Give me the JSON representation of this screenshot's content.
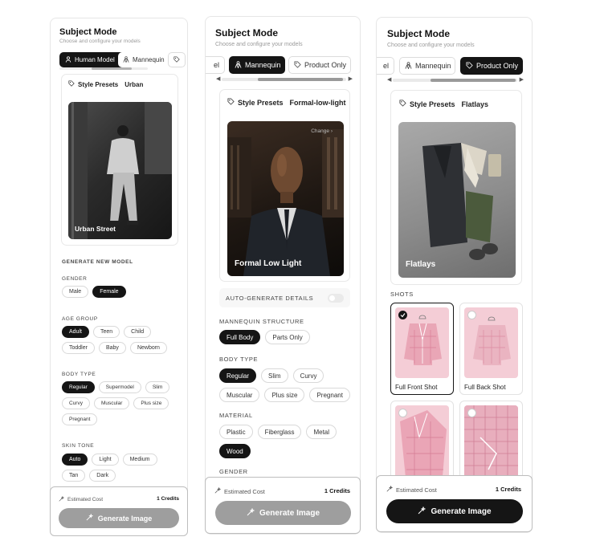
{
  "panel1": {
    "title": "Subject Mode",
    "subtitle": "Choose and configure your models",
    "tabs": [
      {
        "label": "Human Model",
        "icon": "person-icon",
        "active": true
      },
      {
        "label": "Mannequin",
        "icon": "mannequin-icon",
        "active": false
      }
    ],
    "presets_label": "Style Presets",
    "preset_value": "Urban",
    "image_caption": "Urban Street",
    "generate_heading": "GENERATE NEW MODEL",
    "gender_label": "GENDER",
    "gender": [
      "Male",
      "Female"
    ],
    "gender_selected": "Female",
    "age_label": "AGE GROUP",
    "age": [
      "Adult",
      "Teen",
      "Child",
      "Toddler",
      "Baby",
      "Newborn"
    ],
    "age_selected": "Adult",
    "body_label": "BODY TYPE",
    "body": [
      "Regular",
      "Supermodel",
      "Slim",
      "Curvy",
      "Muscular",
      "Plus size",
      "Pregnant"
    ],
    "body_selected": "Regular",
    "skin_label": "SKIN TONE",
    "skin": [
      "Auto",
      "Light",
      "Medium",
      "Tan",
      "Dark"
    ],
    "skin_selected": "Auto",
    "cost_label": "Estimated Cost",
    "credits": "1 Credits",
    "button": "Generate Image",
    "button_enabled": false
  },
  "panel2": {
    "title": "Subject Mode",
    "subtitle": "Choose and configure your models",
    "tabs": [
      {
        "label": "el",
        "icon": "",
        "active": false
      },
      {
        "label": "Mannequin",
        "icon": "mannequin-icon",
        "active": true
      },
      {
        "label": "Product Only",
        "icon": "tag-icon",
        "active": false
      }
    ],
    "presets_label": "Style Presets",
    "preset_value": "Formal-low-light",
    "image_caption": "Formal Low Light",
    "change_label": "Change",
    "auto_label": "AUTO-GENERATE DETAILS",
    "structure_label": "MANNEQUIN STRUCTURE",
    "structure": [
      "Full Body",
      "Parts Only"
    ],
    "structure_selected": "Full Body",
    "body_label": "BODY TYPE",
    "body": [
      "Regular",
      "Slim",
      "Curvy",
      "Muscular",
      "Plus size",
      "Pregnant"
    ],
    "body_selected": "Regular",
    "material_label": "MATERIAL",
    "material": [
      "Plastic",
      "Fiberglass",
      "Metal",
      "Wood"
    ],
    "material_selected": "Wood",
    "gender_label": "GENDER",
    "cost_label": "Estimated Cost",
    "credits": "1 Credits",
    "button": "Generate Image",
    "button_enabled": false
  },
  "panel3": {
    "title": "Subject Mode",
    "subtitle": "Choose and configure your models",
    "tabs": [
      {
        "label": "el",
        "icon": "",
        "active": false
      },
      {
        "label": "Mannequin",
        "icon": "mannequin-icon",
        "active": false
      },
      {
        "label": "Product Only",
        "icon": "tag-icon",
        "active": true
      }
    ],
    "presets_label": "Style Presets",
    "preset_value": "Flatlays",
    "image_caption": "Flatlays",
    "shots_label": "SHOTS",
    "shots": [
      {
        "label": "Full Front Shot",
        "selected": true
      },
      {
        "label": "Full Back Shot",
        "selected": false
      },
      {
        "label": "",
        "selected": false
      },
      {
        "label": "",
        "selected": false
      }
    ],
    "cost_label": "Estimated Cost",
    "credits": "1 Credits",
    "button": "Generate Image",
    "button_enabled": true
  },
  "colors": {
    "accent": "#151515",
    "disabled": "#9e9e9e",
    "border": "#e6e6e6",
    "shot_pink": "#f4cdd6"
  }
}
